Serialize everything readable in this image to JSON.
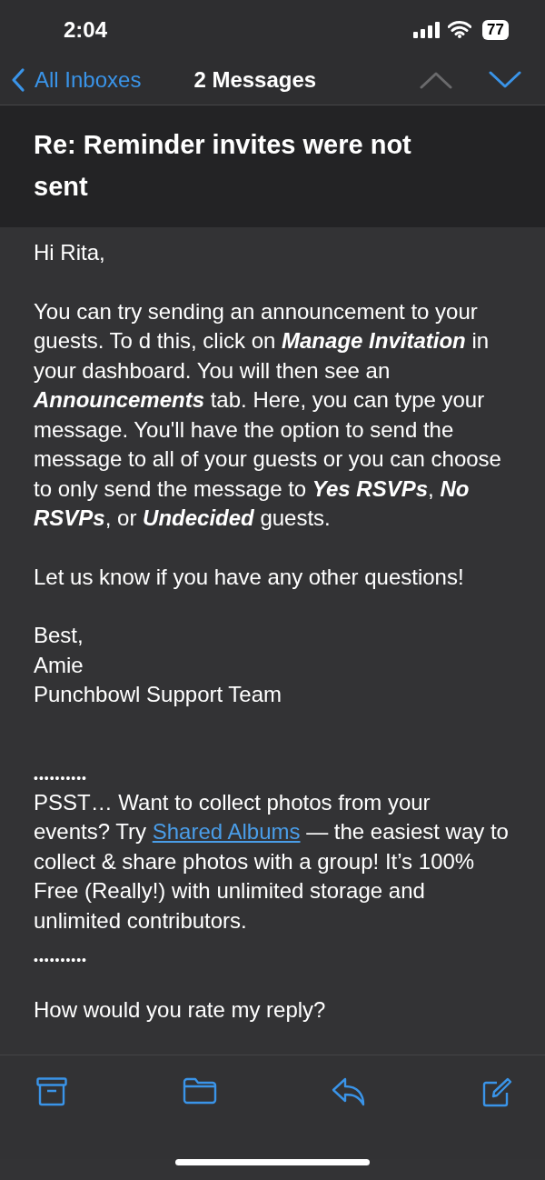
{
  "status_bar": {
    "time": "2:04",
    "battery": "77"
  },
  "nav": {
    "back": "All Inboxes",
    "title": "2 Messages",
    "arrows": [
      {
        "kind": "up",
        "disabled": true
      },
      {
        "kind": "down",
        "disabled": false
      }
    ]
  },
  "subject": "Re: Reminder invites were not sent",
  "body": [
    {
      "kind": "text",
      "text": "Hi Rita,"
    },
    {
      "kind": "text",
      "text": "You can try sending an announcement to your guests. To d this, click on **Manage Invitation** in your dashboard. You will then see an **Announcements** tab. Here, you can type your message. You'll have the option to send the message to all of your guests or you can choose to only send the message to **Yes RSVPs**, **No RSVPs**, or **Undecided** guests."
    },
    {
      "kind": "text",
      "text": "Let us know if you have any other questions!"
    },
    {
      "kind": "lines",
      "lines": [
        "Best,",
        "Amie",
        "Punchbowl Support Team"
      ]
    },
    {
      "kind": "separator",
      "text": "••••••••••"
    },
    {
      "kind": "promo",
      "before": "PSST… Want to collect photos from your events? Try ",
      "link": "Shared Albums",
      "after": " — the easiest way to collect & share photos with a group! It’s 100% Free (Really!) with unlimited storage and unlimited contributors."
    },
    {
      "kind": "separator",
      "text": "••••••••••"
    },
    {
      "kind": "text",
      "text": "How would you rate my reply?"
    }
  ],
  "toolbar": [
    {
      "kind": "archive"
    },
    {
      "kind": "folder"
    },
    {
      "kind": "reply"
    },
    {
      "kind": "compose"
    }
  ]
}
